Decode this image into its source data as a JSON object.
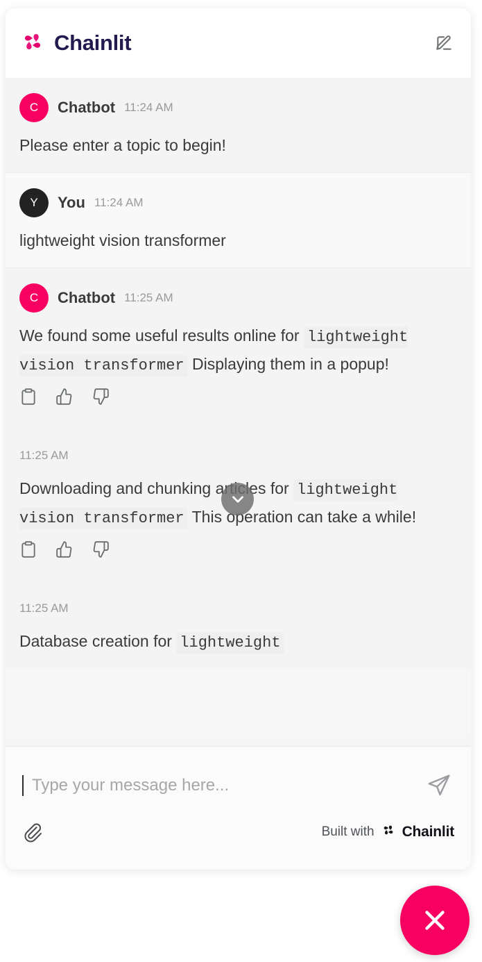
{
  "header": {
    "brand_name": "Chainlit",
    "new_chat_icon": "square-pencil-icon"
  },
  "messages": [
    {
      "author": "Chatbot",
      "avatar_letter": "C",
      "time": "11:24 AM",
      "text": "Please enter a topic to begin!",
      "role": "assistant"
    },
    {
      "author": "You",
      "avatar_letter": "Y",
      "time": "11:24 AM",
      "text": "lightweight vision transformer",
      "role": "user"
    },
    {
      "author": "Chatbot",
      "avatar_letter": "C",
      "time": "11:25 AM",
      "role": "assistant",
      "text_before": "We found some useful results online for",
      "code": "lightweight vision transformer",
      "text_after": "Displaying them in a popup!"
    }
  ],
  "steps": [
    {
      "time": "11:25 AM",
      "text_before": "Downloading and chunking articles for",
      "code": "lightweight vision transformer",
      "text_after": "This operation can take a while!"
    },
    {
      "time": "11:25 AM",
      "text_before": "Database creation for",
      "code": "lightweight",
      "text_after": ""
    }
  ],
  "actions": {
    "copy_label": "clipboard-icon",
    "like_label": "thumbs-up-icon",
    "dislike_label": "thumbs-down-icon"
  },
  "scroll_button": {
    "icon": "chevron-down-icon"
  },
  "composer": {
    "placeholder": "Type your message here...",
    "value": "",
    "send_icon": "send-plane-icon",
    "attach_icon": "paperclip-icon"
  },
  "footer": {
    "built_with_text": "Built with",
    "brand_name": "Chainlit"
  },
  "bubble": {
    "icon": "close-x-icon"
  },
  "colors": {
    "brand_pink": "#f80061",
    "brand_navy": "#231a4f",
    "code_bg": "#efefef",
    "assistant_bg": "#f4f4f4",
    "user_bg": "#f9f9f9"
  }
}
